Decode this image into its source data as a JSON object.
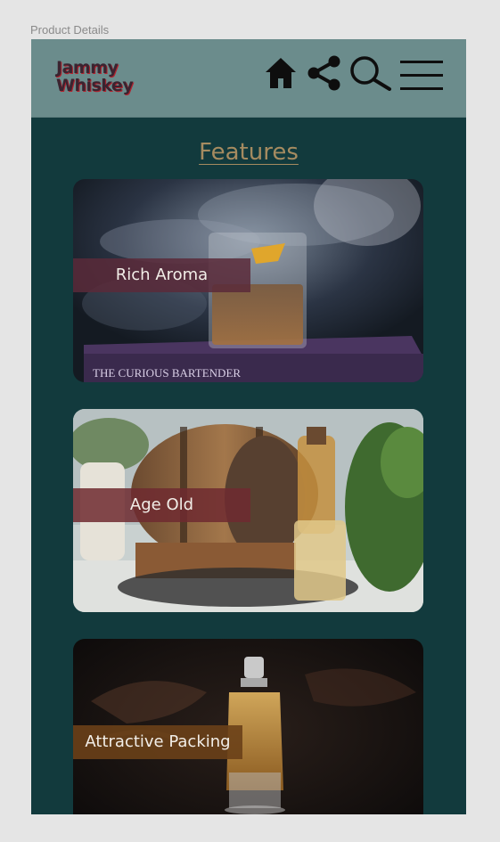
{
  "frame": {
    "label": "Product Details"
  },
  "header": {
    "logo": {
      "line1": "Jammy",
      "line2": "Whiskey"
    },
    "icons": [
      "home-icon",
      "share-icon",
      "search-icon",
      "menu-icon"
    ]
  },
  "main": {
    "title": "Features",
    "cards": [
      {
        "label": "Rich Aroma",
        "book_text": "THE CURIOUS BARTENDER"
      },
      {
        "label": "Age Old"
      },
      {
        "label": "Attractive Packing"
      }
    ]
  },
  "colors": {
    "screen_bg": "#123a3d",
    "header_bg": "#6b8c8c",
    "title": "#a58b60",
    "tag_aroma": "#5a2a3a",
    "tag_age": "#6a2a30",
    "tag_packing": "#6a4018"
  }
}
